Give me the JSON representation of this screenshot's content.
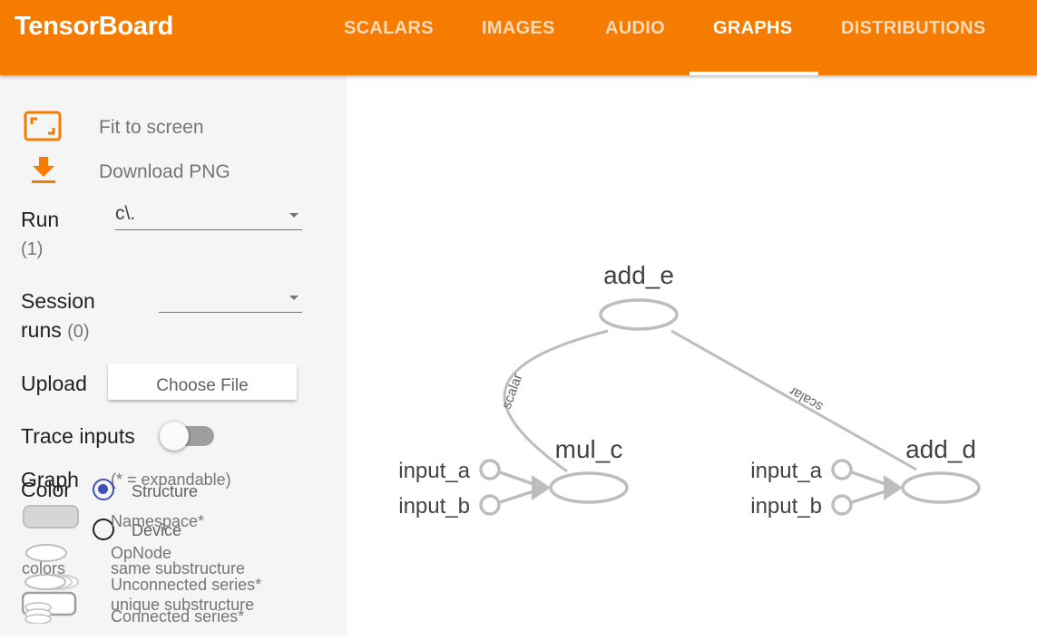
{
  "app": {
    "title": "TensorBoard"
  },
  "tabs": [
    {
      "label": "SCALARS",
      "active": false
    },
    {
      "label": "IMAGES",
      "active": false
    },
    {
      "label": "AUDIO",
      "active": false
    },
    {
      "label": "GRAPHS",
      "active": true
    },
    {
      "label": "DISTRIBUTIONS",
      "active": false
    }
  ],
  "sidebar": {
    "fit_label": "Fit to screen",
    "download_label": "Download PNG",
    "run": {
      "label": "Run",
      "count": "(1)",
      "value": "c\\."
    },
    "session": {
      "label_line1": "Session",
      "label_line2": "runs",
      "count": "(0)",
      "value": ""
    },
    "upload": {
      "label": "Upload",
      "button": "Choose File"
    },
    "trace": {
      "label": "Trace inputs",
      "enabled": false
    },
    "color": {
      "label": "Color",
      "options": [
        {
          "label": "Structure",
          "selected": true
        },
        {
          "label": "Device",
          "selected": false
        }
      ],
      "colors_label": "colors",
      "same": "same substructure",
      "unique": "unique substructure"
    },
    "graph_legend": {
      "label": "Graph",
      "note": "(* = expandable)",
      "namespace": "Namespace*",
      "opnode": "OpNode",
      "unconnected": "Unconnected series*",
      "connected": "Connected series*"
    }
  },
  "graph": {
    "nodes": {
      "add_e": "add_e",
      "mul_c": "mul_c",
      "add_d": "add_d"
    },
    "inputs": {
      "left": {
        "a": "input_a",
        "b": "input_b"
      },
      "right": {
        "a": "input_a",
        "b": "input_b"
      }
    },
    "edge_labels": {
      "left": "scalar",
      "right": "scalar"
    },
    "colors": {
      "node_stroke": "#bdbdbd",
      "edge": "#bdbdbd",
      "text": "#424242"
    }
  },
  "theme": {
    "accent": "#f57c00",
    "radio": "#3f51b5"
  }
}
